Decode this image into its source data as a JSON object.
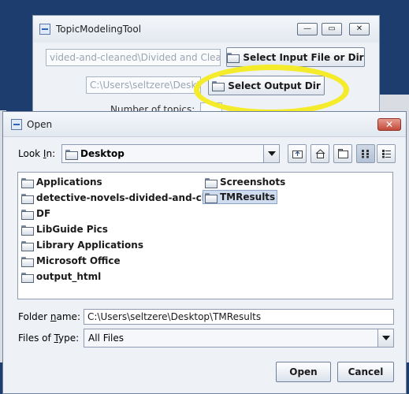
{
  "background_window": {
    "title": "TopicModelingTool",
    "window_controls": [
      "—",
      "▭",
      "✕"
    ],
    "input_path_value": "vided-and-cleaned\\Divided and Cleaned",
    "select_input_label": "Select Input File or Dir",
    "output_path_value": "C:\\Users\\seltzere\\Desktop",
    "select_output_label": "Select Output Dir",
    "partial_row_label": "Number of topics:"
  },
  "dialog": {
    "title": "Open",
    "close_glyph": "✕",
    "look_in_label_prefix": "Look ",
    "look_in_label_mnemonic": "I",
    "look_in_label_suffix": "n:",
    "look_in_value": "Desktop",
    "files": [
      "Applications",
      "detective-novels-divided-and-cleaned",
      "DF",
      "LibGuide Pics",
      "Library Applications",
      "Microsoft Office",
      "output_html",
      "Screenshots",
      "TMResults"
    ],
    "selected_file": "TMResults",
    "folder_name_label_prefix": "Folder ",
    "folder_name_label_mnemonic": "n",
    "folder_name_label_suffix": "ame:",
    "folder_name_value": "C:\\Users\\seltzere\\Desktop\\TMResults",
    "files_of_type_label_prefix": "Files of ",
    "files_of_type_label_mnemonic": "T",
    "files_of_type_label_suffix": "ype:",
    "files_of_type_value": "All Files",
    "open_button": "Open",
    "cancel_button": "Cancel"
  },
  "colors": {
    "highlight": "#f4ec2a",
    "selection": "#cfdcef",
    "desktop": "#1c3d6e"
  }
}
